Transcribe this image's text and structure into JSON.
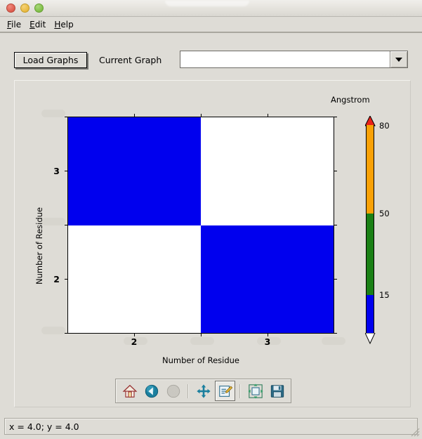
{
  "window": {
    "titlebar_buttons": [
      "close",
      "minimize",
      "maximize"
    ],
    "title": ""
  },
  "menu": {
    "items": [
      {
        "label": "File",
        "mnemonic": "F",
        "rest": "ile"
      },
      {
        "label": "Edit",
        "mnemonic": "E",
        "rest": "dit"
      },
      {
        "label": "Help",
        "mnemonic": "H",
        "rest": "elp"
      }
    ]
  },
  "toolbar": {
    "load_graphs_label": "Load Graphs",
    "current_graph_label": "Current Graph",
    "current_graph_value": "",
    "dropdown_icon": "chevron-down-icon"
  },
  "navbar": {
    "buttons": [
      {
        "name": "home-icon",
        "tooltip": "Home",
        "active": false,
        "enabled": true
      },
      {
        "name": "back-arrow-icon",
        "tooltip": "Back",
        "active": false,
        "enabled": true
      },
      {
        "name": "forward-arrow-icon",
        "tooltip": "Forward",
        "active": false,
        "enabled": false
      },
      {
        "name": "pan-move-icon",
        "tooltip": "Pan",
        "active": false,
        "enabled": true
      },
      {
        "name": "zoom-rect-icon",
        "tooltip": "Zoom to rectangle",
        "active": true,
        "enabled": true
      },
      {
        "name": "subplot-config-icon",
        "tooltip": "Configure subplots",
        "active": false,
        "enabled": true
      },
      {
        "name": "save-floppy-icon",
        "tooltip": "Save figure",
        "active": false,
        "enabled": true
      }
    ]
  },
  "statusbar": {
    "text": "x = 4.0; y = 4.0"
  },
  "chart_data": {
    "type": "heatmap",
    "title": "",
    "xlabel": "Number of Residue",
    "ylabel": "Number of Residue",
    "x_ticklabels": [
      "2",
      "3"
    ],
    "y_ticklabels": [
      "3",
      "2"
    ],
    "xlim": [
      1.5,
      3.5
    ],
    "ylim": [
      1.5,
      3.5
    ],
    "grid": false,
    "cells": [
      {
        "row": 0,
        "col": 0,
        "x": 2,
        "y": 3,
        "value": 0,
        "color": "#0000ee"
      },
      {
        "row": 0,
        "col": 1,
        "x": 3,
        "y": 3,
        "value": null,
        "color": "#ffffff"
      },
      {
        "row": 1,
        "col": 0,
        "x": 2,
        "y": 2,
        "value": null,
        "color": "#ffffff"
      },
      {
        "row": 1,
        "col": 1,
        "x": 3,
        "y": 2,
        "value": 0,
        "color": "#0000ee"
      }
    ],
    "colorbar": {
      "title": "Angstrom",
      "orientation": "vertical",
      "extend": "both",
      "boundaries": [
        15,
        50,
        80
      ],
      "ticklabels": [
        "80",
        "50",
        "15"
      ],
      "segments": [
        {
          "label": "over",
          "color": "#e8221a",
          "shape": "triangle-up"
        },
        {
          "label": "50-80",
          "color": "#f9a106",
          "from": 50,
          "to": 80
        },
        {
          "label": "15-50",
          "color": "#1a8015",
          "from": 15,
          "to": 50
        },
        {
          "label": "0-15",
          "color": "#0000ee",
          "from": 0,
          "to": 15
        },
        {
          "label": "under",
          "color": "#ffffff",
          "shape": "triangle-down"
        }
      ]
    }
  },
  "colors": {
    "window_bg": "#dedcd6",
    "plot_bg": "#ffffff",
    "data_blue": "#0000ee",
    "cbar_red": "#e8221a",
    "cbar_orange": "#f9a106",
    "cbar_green": "#1a8015",
    "cbar_blue": "#0000ee"
  }
}
